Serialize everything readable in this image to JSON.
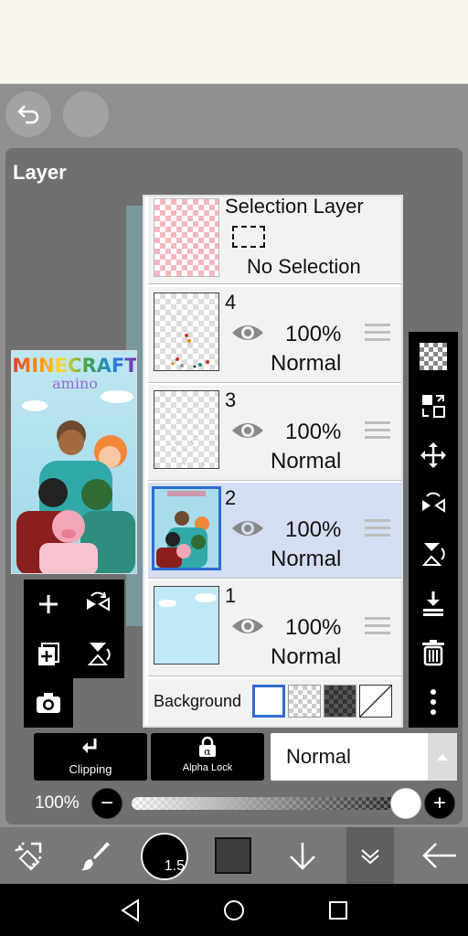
{
  "panel": {
    "title": "Layer"
  },
  "preview": {
    "logo_line1": "MINECRAFT",
    "logo_line2": "amino"
  },
  "selection_layer": {
    "title": "Selection Layer",
    "status": "No Selection"
  },
  "layers": [
    {
      "number": "4",
      "opacity": "100%",
      "mode": "Normal",
      "selected": false
    },
    {
      "number": "3",
      "opacity": "100%",
      "mode": "Normal",
      "selected": false
    },
    {
      "number": "2",
      "opacity": "100%",
      "mode": "Normal",
      "selected": true
    },
    {
      "number": "1",
      "opacity": "100%",
      "mode": "Normal",
      "selected": false
    }
  ],
  "background": {
    "label": "Background"
  },
  "controls": {
    "clipping_label": "Clipping",
    "alpha_lock_label": "Alpha Lock",
    "blend_mode": "Normal",
    "opacity_label": "100%",
    "opacity_value": 1.0
  },
  "toolbar": {
    "brush_size": "1.5"
  },
  "icons": {
    "left_tools": [
      "add-layer-icon",
      "flip-horizontal-icon",
      "copy-layer-icon",
      "flip-vertical-icon",
      "camera-icon"
    ],
    "right_tools": [
      "checkerboard-icon",
      "transform-icon",
      "move-icon",
      "flip-horizontal-icon",
      "flip-vertical-icon",
      "merge-down-icon",
      "trash-icon",
      "more-icon"
    ]
  },
  "colors": {
    "selected_row": "#d4def2",
    "panel": "#707070",
    "accent_blue": "#2f6bd0"
  }
}
